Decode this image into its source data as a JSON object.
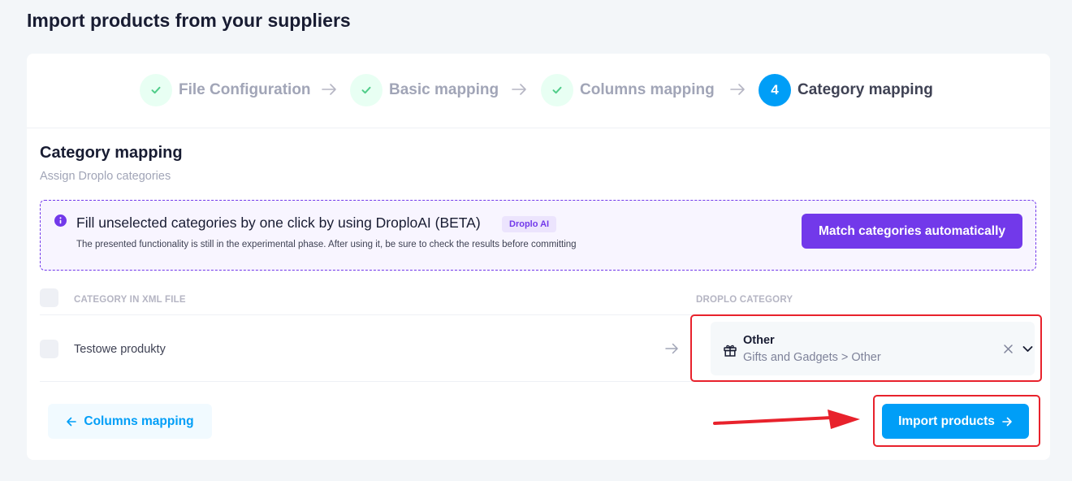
{
  "page": {
    "title": "Import products from your suppliers"
  },
  "stepper": {
    "steps": [
      {
        "label": "File Configuration",
        "state": "done",
        "icon": "check-icon"
      },
      {
        "label": "Basic mapping",
        "state": "done",
        "icon": "check-icon"
      },
      {
        "label": "Columns mapping",
        "state": "done",
        "icon": "check-icon"
      },
      {
        "label": "Category mapping",
        "state": "current",
        "number": "4"
      }
    ],
    "separator_icon": "arrow-right-icon"
  },
  "section": {
    "title": "Category mapping",
    "subtitle": "Assign Droplo categories"
  },
  "ai_banner": {
    "icon": "info-icon",
    "title": "Fill unselected categories by one click by using DroploAI (BETA)",
    "badge": "Droplo AI",
    "description": "The presented functionality is still in the experimental phase. After using it, be sure to check the results before committing",
    "button_label": "Match categories automatically"
  },
  "table": {
    "columns": [
      "CATEGORY IN XML FILE",
      "DROPLO CATEGORY"
    ],
    "rows": [
      {
        "xml_category": "Testowe produkty",
        "droplo_category": {
          "icon": "gift-icon",
          "name": "Other",
          "path": "Gifts and Gadgets > Other"
        }
      }
    ]
  },
  "footer": {
    "back_label": "Columns mapping",
    "import_label": "Import products"
  },
  "colors": {
    "primary": "#009ef7",
    "purple": "#7239ea",
    "success": "#50cd89",
    "annotation_red": "#e8222c"
  }
}
